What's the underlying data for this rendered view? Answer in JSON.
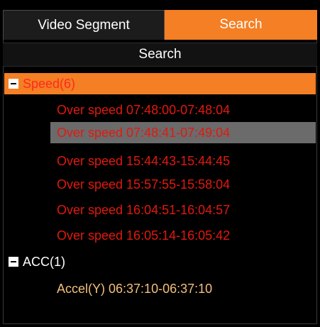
{
  "tabs": {
    "video_segment": "Video Segment",
    "search": "Search"
  },
  "list_header": "Search",
  "groups": [
    {
      "label": "Speed(6)",
      "items": [
        "Over speed 07:48:00-07:48:04",
        "Over speed 07:48:41-07:49:04",
        "Over speed 15:44:43-15:44:45",
        "Over speed 15:57:55-15:58:04",
        "Over speed 16:04:51-16:04:57",
        "Over speed 16:05:14-16:05:42"
      ]
    },
    {
      "label": "ACC(1)",
      "items": [
        "Accel(Y) 06:37:10-06:37:10"
      ]
    }
  ],
  "colors": {
    "accent": "#f47f24",
    "alert_red": "#e1190f",
    "selected_row": "#6b6b6b",
    "acc_item": "#f3c07b"
  }
}
